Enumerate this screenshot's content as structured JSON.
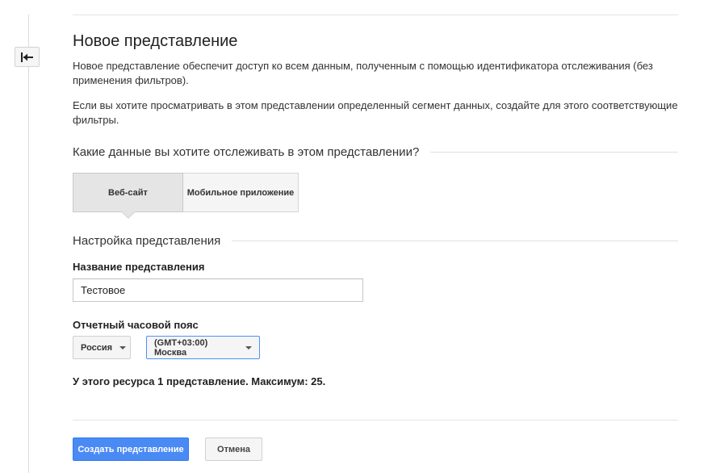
{
  "title": "Новое представление",
  "description": {
    "paragraph1": "Новое представление обеспечит доступ ко всем данным, полученным с помощью идентификатора отслеживания (без применения фильтров).",
    "paragraph2": "Если вы хотите просматривать в этом представлении определенный сегмент данных, создайте для этого соответствующие фильтры."
  },
  "tracking_section": {
    "heading": "Какие данные вы хотите отслеживать в этом представлении?",
    "tabs": [
      {
        "label": "Веб-сайт",
        "selected": true
      },
      {
        "label": "Мобильное приложение",
        "selected": false
      }
    ]
  },
  "settings_section": {
    "heading": "Настройка представления",
    "name_label": "Название представления",
    "name_value": "Тестовое",
    "timezone_label": "Отчетный часовой пояс",
    "country_value": "Россия",
    "timezone_value": "(GMT+03:00) Москва"
  },
  "note": "У этого ресурса 1 представление. Максимум: 25.",
  "buttons": {
    "create": "Создать представление",
    "cancel": "Отмена"
  },
  "colors": {
    "primary": "#4a8af4",
    "focus_border": "#4d90fe"
  },
  "icons": {
    "back": "back-arrow-icon"
  }
}
